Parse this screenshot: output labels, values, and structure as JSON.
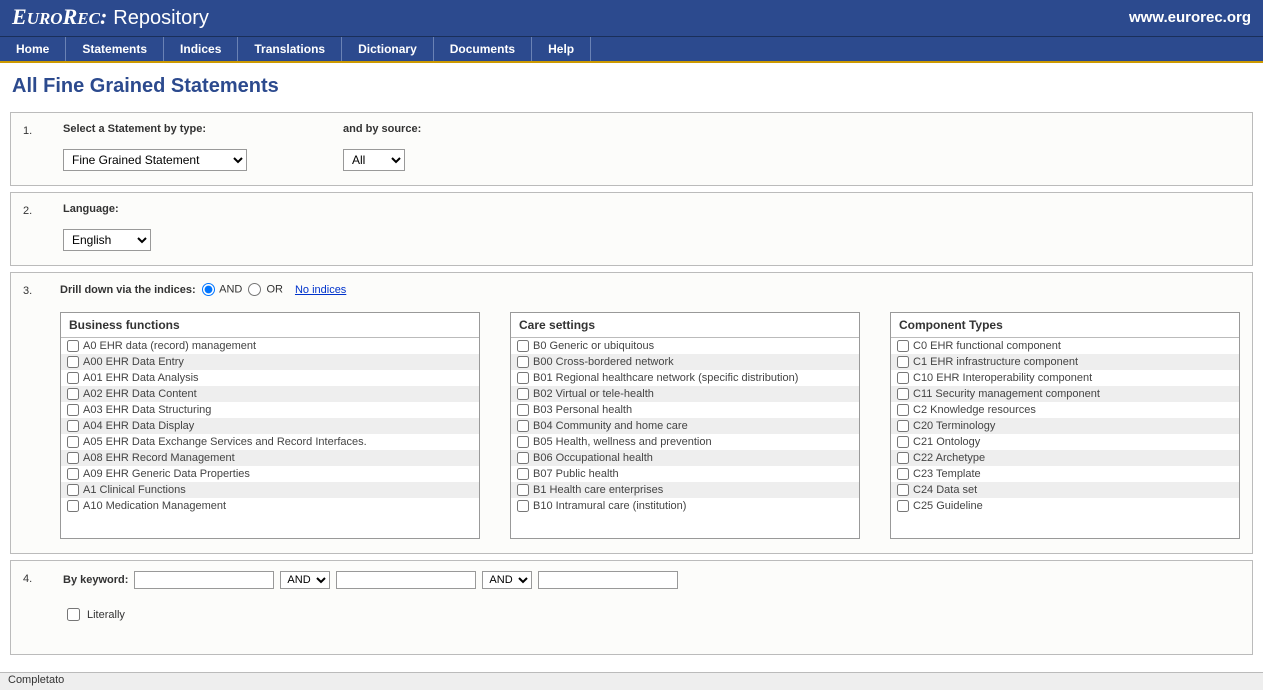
{
  "header": {
    "logo_euro": "E",
    "logo_uro": "URO",
    "logo_rec_r": "R",
    "logo_rec_ec": "EC",
    "logo_colon": ":",
    "repo": "Repository",
    "url": "www.eurorec.org"
  },
  "nav": [
    "Home",
    "Statements",
    "Indices",
    "Translations",
    "Dictionary",
    "Documents",
    "Help"
  ],
  "page_title": "All Fine Grained Statements",
  "step1": {
    "num": "1.",
    "label_type": "Select a Statement by type:",
    "label_source": "and by source:",
    "select_type": "Fine Grained Statement",
    "select_source": "All"
  },
  "step2": {
    "num": "2.",
    "label": "Language:",
    "select": "English"
  },
  "step3": {
    "num": "3.",
    "label": "Drill down via the indices:",
    "radio_and": "AND",
    "radio_or": "OR",
    "link": "No indices",
    "boxes": [
      {
        "header": "Business functions",
        "items": [
          "A0 EHR data (record) management",
          "A00 EHR Data Entry",
          "A01 EHR Data Analysis",
          "A02 EHR Data Content",
          "A03 EHR Data Structuring",
          "A04 EHR Data Display",
          "A05 EHR Data Exchange Services and Record Interfaces.",
          "A08 EHR Record Management",
          "A09 EHR Generic Data Properties",
          "A1 Clinical Functions",
          "A10 Medication Management"
        ]
      },
      {
        "header": "Care settings",
        "items": [
          "B0 Generic or ubiquitous",
          "B00 Cross-bordered network",
          "B01 Regional healthcare network (specific distribution)",
          "B02 Virtual or tele-health",
          "B03 Personal health",
          "B04 Community and home care",
          "B05 Health, wellness and prevention",
          "B06 Occupational health",
          "B07 Public health",
          "B1 Health care enterprises",
          "B10 Intramural care (institution)"
        ]
      },
      {
        "header": "Component Types",
        "items": [
          "C0 EHR functional component",
          "C1 EHR infrastructure component",
          "C10 EHR Interoperability component",
          "C11 Security management component",
          "C2 Knowledge resources",
          "C20 Terminology",
          "C21 Ontology",
          "C22 Archetype",
          "C23 Template",
          "C24 Data set",
          "C25 Guideline"
        ]
      }
    ]
  },
  "step4": {
    "num": "4.",
    "label": "By keyword:",
    "and1": "AND",
    "and2": "AND",
    "literally": "Literally"
  },
  "statusbar": "Completato"
}
